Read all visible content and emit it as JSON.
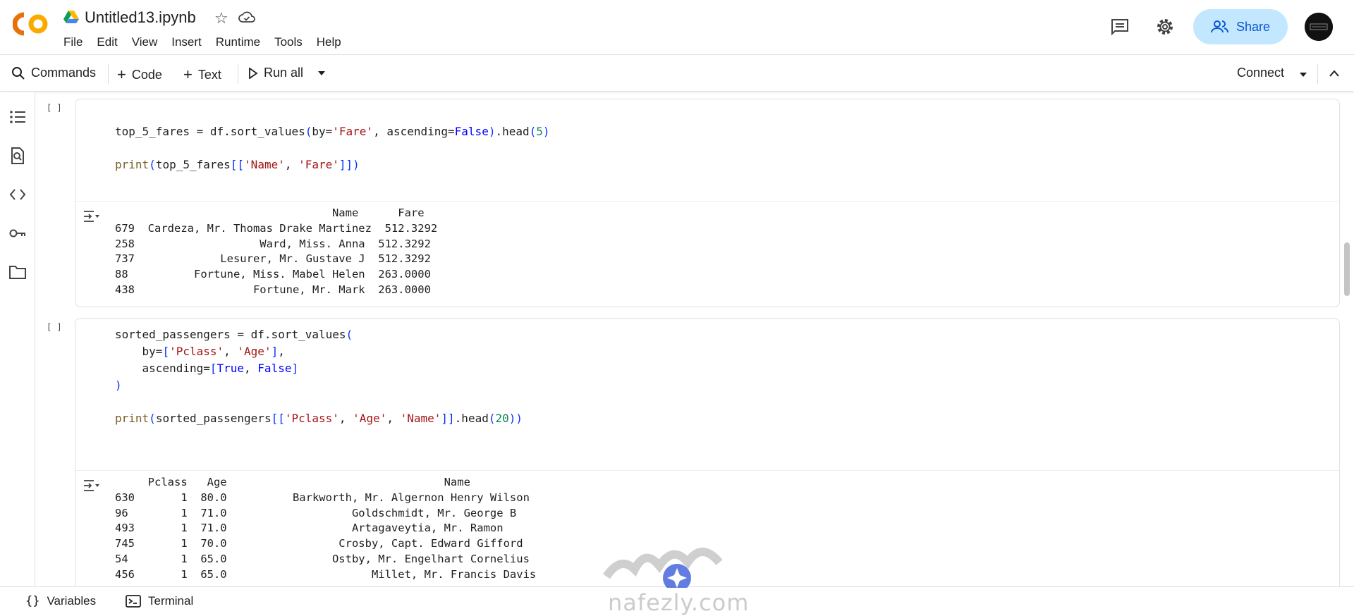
{
  "header": {
    "title": "Untitled13.ipynb",
    "menu": [
      "File",
      "Edit",
      "View",
      "Insert",
      "Runtime",
      "Tools",
      "Help"
    ],
    "share_label": "Share"
  },
  "toolbar": {
    "commands_label": "Commands",
    "code_label": "Code",
    "text_label": "Text",
    "run_all_label": "Run all",
    "connect_label": "Connect"
  },
  "cells": [
    {
      "exec_count": "[ ]",
      "code_lines": [
        "top_5_fares = df.sort_values(by='Fare', ascending=False).head(5)",
        "",
        "print(top_5_fares[['Name', 'Fare']])"
      ],
      "output_lines": [
        "                                 Name      Fare",
        "679  Cardeza, Mr. Thomas Drake Martinez  512.3292",
        "258                   Ward, Miss. Anna  512.3292",
        "737             Lesurer, Mr. Gustave J  512.3292",
        "88          Fortune, Miss. Mabel Helen  263.0000",
        "438                  Fortune, Mr. Mark  263.0000"
      ]
    },
    {
      "exec_count": "[ ]",
      "code_lines": [
        "sorted_passengers = df.sort_values(",
        "    by=['Pclass', 'Age'],",
        "    ascending=[True, False]",
        ")",
        "",
        "print(sorted_passengers[['Pclass', 'Age', 'Name']].head(20))"
      ],
      "output_lines": [
        "     Pclass   Age                                 Name",
        "630       1  80.0          Barkworth, Mr. Algernon Henry Wilson",
        "96        1  71.0                   Goldschmidt, Mr. George B",
        "493       1  71.0                   Artagaveytia, Mr. Ramon",
        "745       1  70.0                 Crosby, Capt. Edward Gifford",
        "54        1  65.0                Ostby, Mr. Engelhart Cornelius",
        "456       1  65.0                      Millet, Mr. Francis Davis"
      ]
    }
  ],
  "bottombar": {
    "variables_label": "Variables",
    "terminal_label": "Terminal"
  },
  "watermark": {
    "text": "nafezly.com"
  },
  "colors": {
    "share_bg": "#c2e7ff",
    "share_fg": "#0b57d0",
    "logo_orange": "#f9ab00",
    "logo_dark_orange": "#e8710a"
  }
}
